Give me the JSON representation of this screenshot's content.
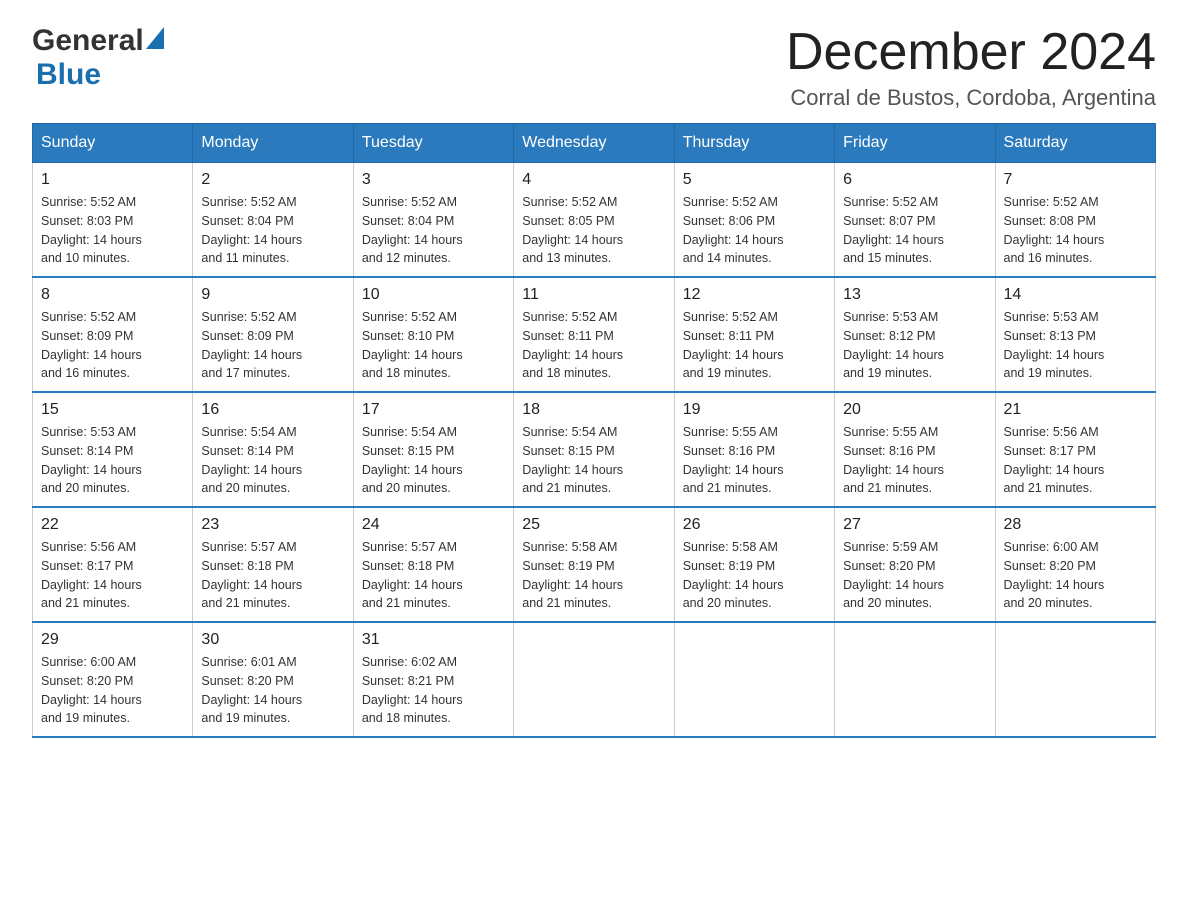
{
  "header": {
    "logo_general": "General",
    "logo_blue": "Blue",
    "month_title": "December 2024",
    "location": "Corral de Bustos, Cordoba, Argentina"
  },
  "weekdays": [
    "Sunday",
    "Monday",
    "Tuesday",
    "Wednesday",
    "Thursday",
    "Friday",
    "Saturday"
  ],
  "weeks": [
    [
      {
        "day": "1",
        "sunrise": "5:52 AM",
        "sunset": "8:03 PM",
        "daylight": "14 hours and 10 minutes."
      },
      {
        "day": "2",
        "sunrise": "5:52 AM",
        "sunset": "8:04 PM",
        "daylight": "14 hours and 11 minutes."
      },
      {
        "day": "3",
        "sunrise": "5:52 AM",
        "sunset": "8:04 PM",
        "daylight": "14 hours and 12 minutes."
      },
      {
        "day": "4",
        "sunrise": "5:52 AM",
        "sunset": "8:05 PM",
        "daylight": "14 hours and 13 minutes."
      },
      {
        "day": "5",
        "sunrise": "5:52 AM",
        "sunset": "8:06 PM",
        "daylight": "14 hours and 14 minutes."
      },
      {
        "day": "6",
        "sunrise": "5:52 AM",
        "sunset": "8:07 PM",
        "daylight": "14 hours and 15 minutes."
      },
      {
        "day": "7",
        "sunrise": "5:52 AM",
        "sunset": "8:08 PM",
        "daylight": "14 hours and 16 minutes."
      }
    ],
    [
      {
        "day": "8",
        "sunrise": "5:52 AM",
        "sunset": "8:09 PM",
        "daylight": "14 hours and 16 minutes."
      },
      {
        "day": "9",
        "sunrise": "5:52 AM",
        "sunset": "8:09 PM",
        "daylight": "14 hours and 17 minutes."
      },
      {
        "day": "10",
        "sunrise": "5:52 AM",
        "sunset": "8:10 PM",
        "daylight": "14 hours and 18 minutes."
      },
      {
        "day": "11",
        "sunrise": "5:52 AM",
        "sunset": "8:11 PM",
        "daylight": "14 hours and 18 minutes."
      },
      {
        "day": "12",
        "sunrise": "5:52 AM",
        "sunset": "8:11 PM",
        "daylight": "14 hours and 19 minutes."
      },
      {
        "day": "13",
        "sunrise": "5:53 AM",
        "sunset": "8:12 PM",
        "daylight": "14 hours and 19 minutes."
      },
      {
        "day": "14",
        "sunrise": "5:53 AM",
        "sunset": "8:13 PM",
        "daylight": "14 hours and 19 minutes."
      }
    ],
    [
      {
        "day": "15",
        "sunrise": "5:53 AM",
        "sunset": "8:14 PM",
        "daylight": "14 hours and 20 minutes."
      },
      {
        "day": "16",
        "sunrise": "5:54 AM",
        "sunset": "8:14 PM",
        "daylight": "14 hours and 20 minutes."
      },
      {
        "day": "17",
        "sunrise": "5:54 AM",
        "sunset": "8:15 PM",
        "daylight": "14 hours and 20 minutes."
      },
      {
        "day": "18",
        "sunrise": "5:54 AM",
        "sunset": "8:15 PM",
        "daylight": "14 hours and 21 minutes."
      },
      {
        "day": "19",
        "sunrise": "5:55 AM",
        "sunset": "8:16 PM",
        "daylight": "14 hours and 21 minutes."
      },
      {
        "day": "20",
        "sunrise": "5:55 AM",
        "sunset": "8:16 PM",
        "daylight": "14 hours and 21 minutes."
      },
      {
        "day": "21",
        "sunrise": "5:56 AM",
        "sunset": "8:17 PM",
        "daylight": "14 hours and 21 minutes."
      }
    ],
    [
      {
        "day": "22",
        "sunrise": "5:56 AM",
        "sunset": "8:17 PM",
        "daylight": "14 hours and 21 minutes."
      },
      {
        "day": "23",
        "sunrise": "5:57 AM",
        "sunset": "8:18 PM",
        "daylight": "14 hours and 21 minutes."
      },
      {
        "day": "24",
        "sunrise": "5:57 AM",
        "sunset": "8:18 PM",
        "daylight": "14 hours and 21 minutes."
      },
      {
        "day": "25",
        "sunrise": "5:58 AM",
        "sunset": "8:19 PM",
        "daylight": "14 hours and 21 minutes."
      },
      {
        "day": "26",
        "sunrise": "5:58 AM",
        "sunset": "8:19 PM",
        "daylight": "14 hours and 20 minutes."
      },
      {
        "day": "27",
        "sunrise": "5:59 AM",
        "sunset": "8:20 PM",
        "daylight": "14 hours and 20 minutes."
      },
      {
        "day": "28",
        "sunrise": "6:00 AM",
        "sunset": "8:20 PM",
        "daylight": "14 hours and 20 minutes."
      }
    ],
    [
      {
        "day": "29",
        "sunrise": "6:00 AM",
        "sunset": "8:20 PM",
        "daylight": "14 hours and 19 minutes."
      },
      {
        "day": "30",
        "sunrise": "6:01 AM",
        "sunset": "8:20 PM",
        "daylight": "14 hours and 19 minutes."
      },
      {
        "day": "31",
        "sunrise": "6:02 AM",
        "sunset": "8:21 PM",
        "daylight": "14 hours and 18 minutes."
      },
      null,
      null,
      null,
      null
    ]
  ],
  "labels": {
    "sunrise": "Sunrise:",
    "sunset": "Sunset:",
    "daylight": "Daylight:"
  }
}
